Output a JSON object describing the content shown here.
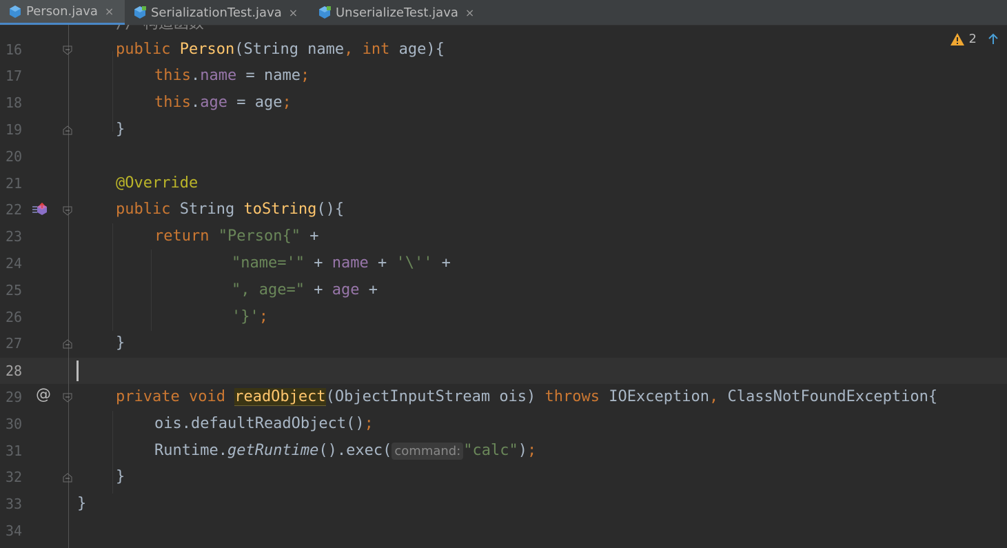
{
  "tabs": [
    {
      "label": "Person.java",
      "active": true
    },
    {
      "label": "SerializationTest.java",
      "active": false
    },
    {
      "label": "UnserializeTest.java",
      "active": false
    }
  ],
  "tab_close_glyph": "×",
  "warnings": {
    "count": "2"
  },
  "gutter_marker_at": "@",
  "hint_command": "command:",
  "line_numbers": [
    "16",
    "17",
    "18",
    "19",
    "20",
    "21",
    "22",
    "23",
    "24",
    "25",
    "26",
    "27",
    "28",
    "29",
    "30",
    "31",
    "32",
    "33",
    "34"
  ],
  "code": {
    "l15_partial": "// 构造函数",
    "l16": {
      "kw": "public",
      "name": "Person",
      "p1": "(String name",
      "comma": ",",
      "int": "int",
      "p2": " age){"
    },
    "l17": {
      "this": "this",
      "dot": ".",
      "field": "name",
      "rest": " = name",
      "semi": ";"
    },
    "l18": {
      "this": "this",
      "dot": ".",
      "field": "age",
      "rest": " = age",
      "semi": ";"
    },
    "l19": "}",
    "l21": "@Override",
    "l22": {
      "kw": "public",
      "type": " String ",
      "name": "toString",
      "rest": "(){"
    },
    "l23": {
      "kw": "return",
      "str": "\"Person{\"",
      "rest": " +"
    },
    "l24": {
      "str1": "\"name='\"",
      "op1": " + ",
      "field": "name",
      "op2": " + ",
      "str2": "'\\''",
      "op3": " +"
    },
    "l25": {
      "str": "\", age=\"",
      "op1": " + ",
      "field": "age",
      "op2": " +"
    },
    "l26": {
      "str": "'}'",
      "semi": ";"
    },
    "l27": "}",
    "l29": {
      "kw1": "private",
      "kw2": "void",
      "name": "readObject",
      "p1": "(ObjectInputStream ois) ",
      "throws": "throws",
      "p2": " IOException",
      "comma": ",",
      "p3": " ClassNotFoundException{"
    },
    "l30": {
      "text": "ois.defaultReadObject()",
      "semi": ";"
    },
    "l31": {
      "p1": "Runtime.",
      "it": "getRuntime",
      "p2": "().exec(",
      "str": "\"calc\"",
      "p3": ")",
      "semi": ";"
    },
    "l32": "}",
    "l33": "}"
  },
  "colors": {
    "keyword": "#cc7832",
    "field": "#9876aa",
    "function": "#ffc66d",
    "string": "#6a8759",
    "annotation": "#bbb529",
    "plain": "#a9b7c6",
    "accent": "#4a88c7"
  }
}
